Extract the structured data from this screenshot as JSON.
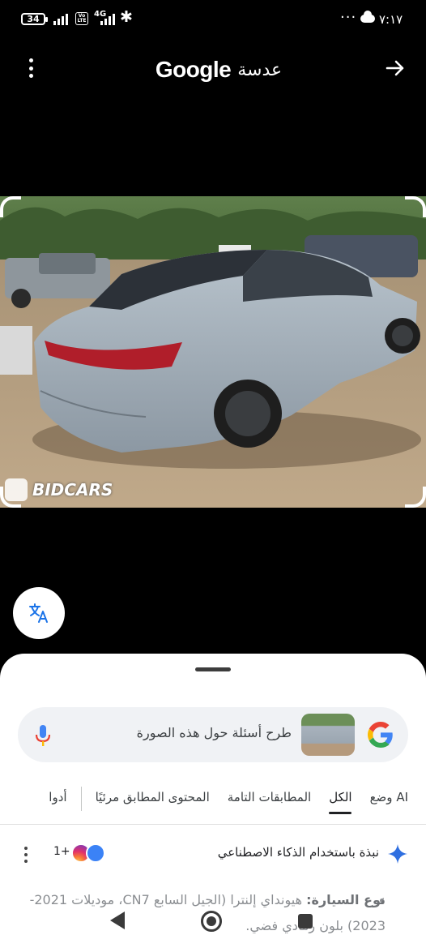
{
  "status_bar": {
    "battery": "34",
    "volte": "Vo LTE",
    "network": "4G",
    "dots": "···",
    "time": "٧:١٧"
  },
  "header": {
    "brand": "Google",
    "title": "عدسة"
  },
  "image": {
    "watermark": "BIDCARS"
  },
  "search": {
    "placeholder": "طرح أسئلة حول هذه الصورة"
  },
  "tabs": [
    {
      "label": "وضع AI",
      "active": false
    },
    {
      "label": "الكل",
      "active": true
    },
    {
      "label": "المطابقات التامة",
      "active": false
    },
    {
      "label": "المحتوى المطابق مرئيًا",
      "active": false
    },
    {
      "label": "أدوا",
      "active": false
    }
  ],
  "ai_overview": {
    "label": "نبذة باستخدام الذكاء الاصطناعي",
    "sources_count": "1+"
  },
  "result_bullet": {
    "bold": "نوع السيارة:",
    "text": " هيونداي إلنترا (الجيل السابع CN7، موديلات 2021-2023) بلون رمادي فضي."
  },
  "colors": {
    "accent_blue": "#4285F4",
    "sparkle_blue": "#2f6fe0",
    "sheet_bg": "#ffffff",
    "search_bg": "#f0f2f5"
  },
  "icons": [
    "battery-icon",
    "signal-icon",
    "bluetooth-icon",
    "cloud-icon",
    "menu-icon",
    "arrow-forward-icon",
    "translate-icon",
    "mic-icon",
    "google-logo-icon",
    "sparkle-icon",
    "more-vert-icon",
    "back-icon",
    "home-icon",
    "recents-icon"
  ]
}
